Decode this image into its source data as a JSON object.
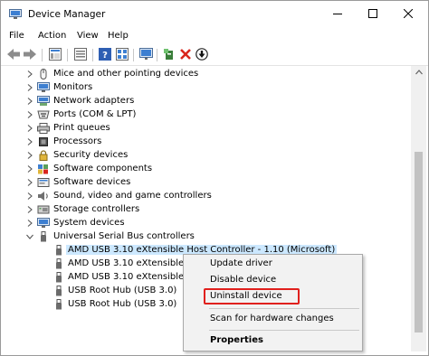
{
  "window": {
    "title": "Device Manager",
    "app_icon": "device-manager-icon"
  },
  "caption_buttons": {
    "minimize": "minimize-icon",
    "maximize": "maximize-icon",
    "close": "close-icon"
  },
  "menu": [
    "File",
    "Action",
    "View",
    "Help"
  ],
  "toolbar": [
    "back-icon",
    "forward-icon",
    "properties-sheet-icon",
    "show-hidden-icon",
    "help-icon",
    "view-list-icon",
    "monitor-scan-icon",
    "add-driver-icon",
    "uninstall-x-icon",
    "download-driver-icon"
  ],
  "tree": {
    "categories": [
      "Mice and other pointing devices",
      "Monitors",
      "Network adapters",
      "Ports (COM & LPT)",
      "Print queues",
      "Processors",
      "Security devices",
      "Software components",
      "Software devices",
      "Sound, video and game controllers",
      "Storage controllers",
      "System devices",
      "Universal Serial Bus controllers"
    ],
    "usb_children": [
      "AMD USB 3.10 eXtensible Host Controller - 1.10 (Microsoft)",
      "AMD USB 3.10 eXtensible Ho",
      "AMD USB 3.10 eXtensible Ho",
      "USB Root Hub (USB 3.0)",
      "USB Root Hub (USB 3.0)"
    ]
  },
  "context_menu": {
    "update_driver": "Update driver",
    "disable_device": "Disable device",
    "uninstall_device": "Uninstall device",
    "scan_changes": "Scan for hardware changes",
    "properties": "Properties"
  },
  "colors": {
    "highlight_box": "#e0201d",
    "selection": "#cce8ff",
    "accent_blue": "#1a6fc9"
  }
}
